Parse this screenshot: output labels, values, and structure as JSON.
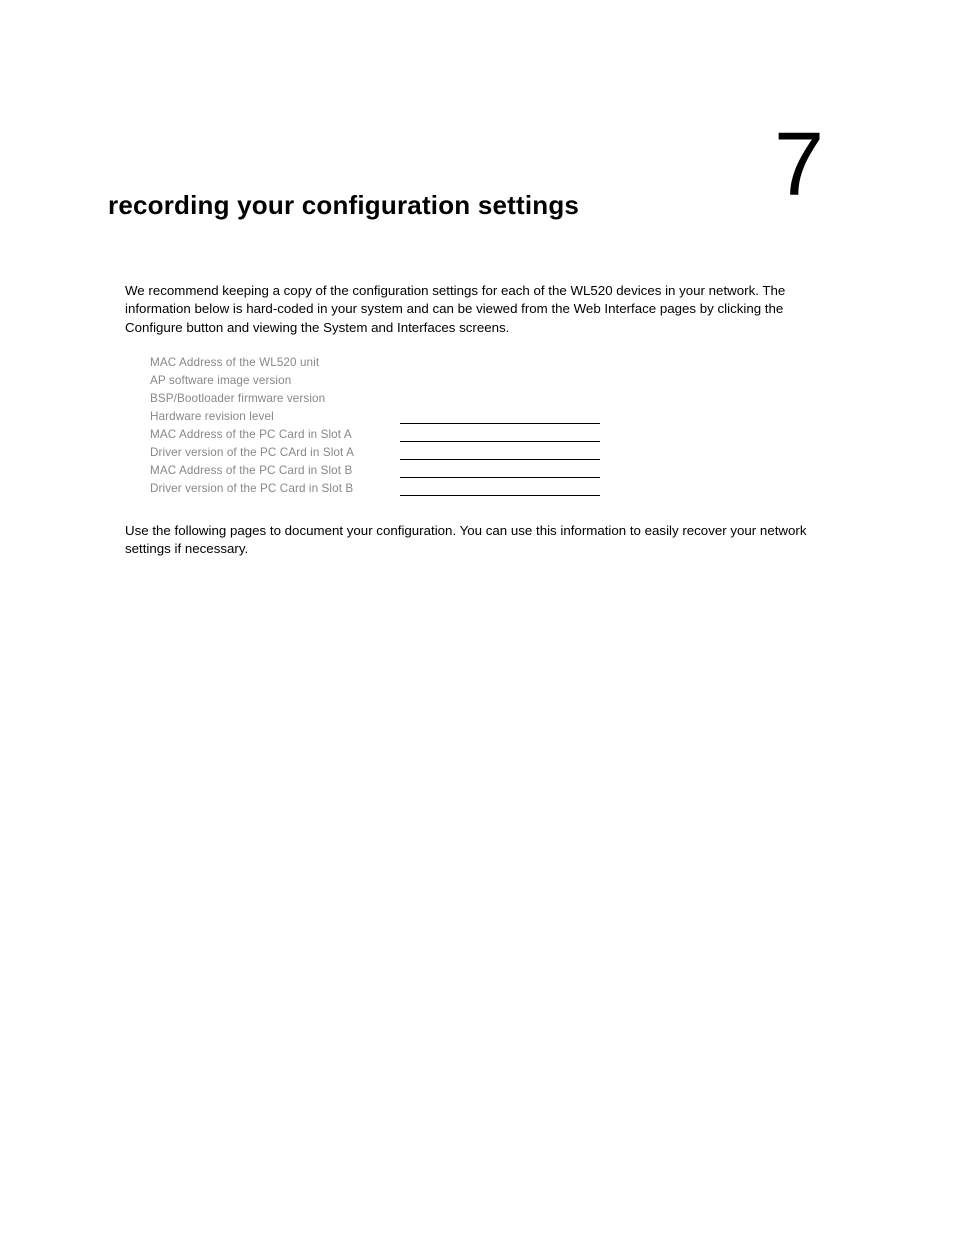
{
  "chapter_number": "7",
  "title": "recording your configuration settings",
  "intro": "We recommend keeping a copy of the configuration settings for each of the WL520 devices in your network. The information below is hard-coded in your system and can be viewed from the Web Interface pages by clicking the Configure button and viewing the System and Interfaces screens.",
  "rows": [
    {
      "label": "MAC Address of the WL520 unit",
      "has_line": false
    },
    {
      "label": "AP software image version",
      "has_line": false
    },
    {
      "label": "BSP/Bootloader firmware version",
      "has_line": false
    },
    {
      "label": "Hardware revision level",
      "has_line": true
    },
    {
      "label": "MAC Address of the PC Card in Slot A",
      "has_line": true
    },
    {
      "label": "Driver version of the PC CArd in Slot A",
      "has_line": true
    },
    {
      "label": "MAC Address of the PC Card in Slot B",
      "has_line": true
    },
    {
      "label": "Driver version of the PC Card in Slot B",
      "has_line": true
    }
  ],
  "followup": "Use the following pages to document your configuration.  You can use this information to easily recover your network settings if necessary."
}
